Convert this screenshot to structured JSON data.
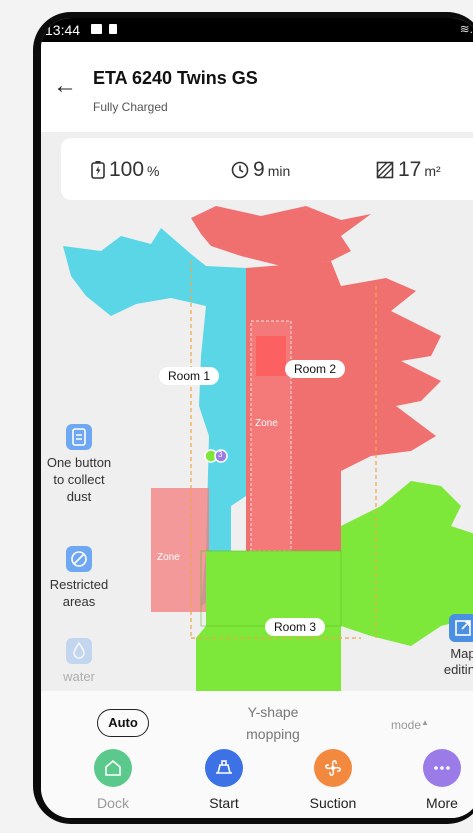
{
  "status_bar": {
    "time": "13:44"
  },
  "header": {
    "title": "ETA 6240 Twins GS",
    "subtitle": "Fully Charged"
  },
  "stats": {
    "battery": {
      "value": "100",
      "unit": "%"
    },
    "time": {
      "value": "9",
      "unit": "min"
    },
    "area": {
      "value": "17",
      "unit": "m²"
    }
  },
  "map": {
    "rooms": [
      "Room 1",
      "Room 2",
      "Room 3"
    ],
    "zone_label": "Zone",
    "robot_badge": "3",
    "colors": {
      "room1": "#5ad6e6",
      "room2": "#f07070",
      "room3": "#7ee83a",
      "zone": "#f57c7c"
    }
  },
  "side_tools": [
    {
      "label": "One button to collect dust",
      "icon": "dust-collect-icon"
    },
    {
      "label": "Restricted areas",
      "icon": "restricted-area-icon"
    },
    {
      "label": "water",
      "icon": "water-drop-icon"
    }
  ],
  "map_edit": {
    "label": "Map editing",
    "icon": "map-edit-icon"
  },
  "modes": {
    "auto": "Auto",
    "y_shape": "Y-shape mopping",
    "mode": "mode"
  },
  "actions": [
    {
      "label": "Dock",
      "icon": "home-icon",
      "color": "#5cc98c"
    },
    {
      "label": "Start",
      "icon": "vacuum-icon",
      "color": "#3d72e6"
    },
    {
      "label": "Suction",
      "icon": "suction-fan-icon",
      "color": "#f3893f"
    },
    {
      "label": "More",
      "icon": "more-dots-icon",
      "color": "#9b7be8"
    }
  ]
}
